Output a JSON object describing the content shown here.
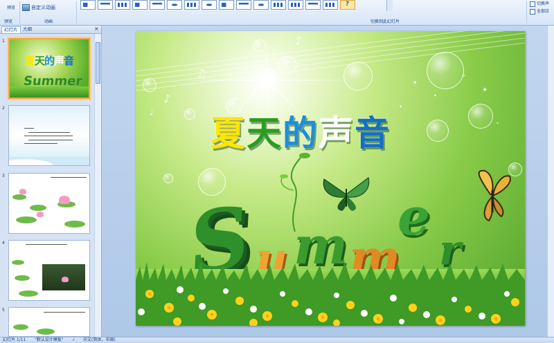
{
  "ribbon": {
    "preview_label": "预览",
    "preview_group_label": "预览",
    "custom_animation_label": "自定义动画",
    "animation_group_label": "动画",
    "transition_group_label": "切换到此幻灯片",
    "right_options": [
      "切换声",
      "全部应"
    ]
  },
  "left_panel": {
    "tab_slides": "幻灯片",
    "tab_outline": "大纲",
    "close_glyph": "×",
    "slides": [
      {
        "num": "1",
        "title": "夏天的声音",
        "word": "Summer"
      },
      {
        "num": "2"
      },
      {
        "num": "3"
      },
      {
        "num": "4"
      },
      {
        "num": "5"
      }
    ]
  },
  "slide": {
    "title_chars": [
      "夏",
      "天",
      "的",
      "声",
      "音"
    ],
    "summer_letters": [
      "S",
      "u",
      "m",
      "m",
      "e",
      "r"
    ]
  },
  "colors": {
    "title": [
      "#ffe600",
      "#2a9d20",
      "#1a8fdc",
      "#ffffff",
      "#1370c8"
    ],
    "summer": [
      "#2f8f2a",
      "#f0a232",
      "#3b9b2e",
      "#e08a24",
      "#3aa336",
      "#2f8f2a"
    ]
  },
  "status": {
    "slide_count": "幻灯片 1/11",
    "theme": "\"默认设计模板\"",
    "language": "中文(简体，中国)"
  }
}
